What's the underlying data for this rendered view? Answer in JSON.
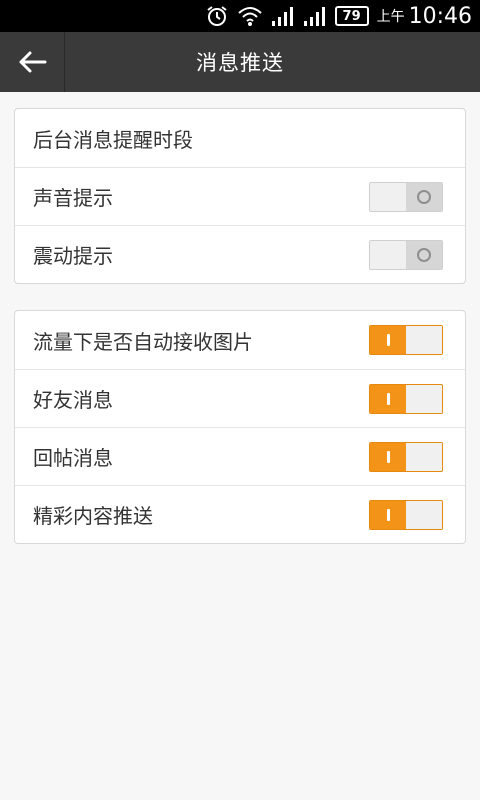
{
  "status_bar": {
    "battery": "79",
    "ampm": "上午",
    "time": "10:46"
  },
  "header": {
    "title": "消息推送",
    "back_icon": "arrow-left-icon"
  },
  "group1": {
    "items": [
      {
        "label": "后台消息提醒时段"
      },
      {
        "label": "声音提示",
        "toggle": "off"
      },
      {
        "label": "震动提示",
        "toggle": "off"
      }
    ]
  },
  "group2": {
    "items": [
      {
        "label": "流量下是否自动接收图片",
        "toggle": "on"
      },
      {
        "label": "好友消息",
        "toggle": "on"
      },
      {
        "label": "回帖消息",
        "toggle": "on"
      },
      {
        "label": "精彩内容推送",
        "toggle": "on"
      }
    ]
  },
  "colors": {
    "accent": "#f39418",
    "header_bg": "#3a3a3a",
    "page_bg": "#f7f7f7"
  }
}
